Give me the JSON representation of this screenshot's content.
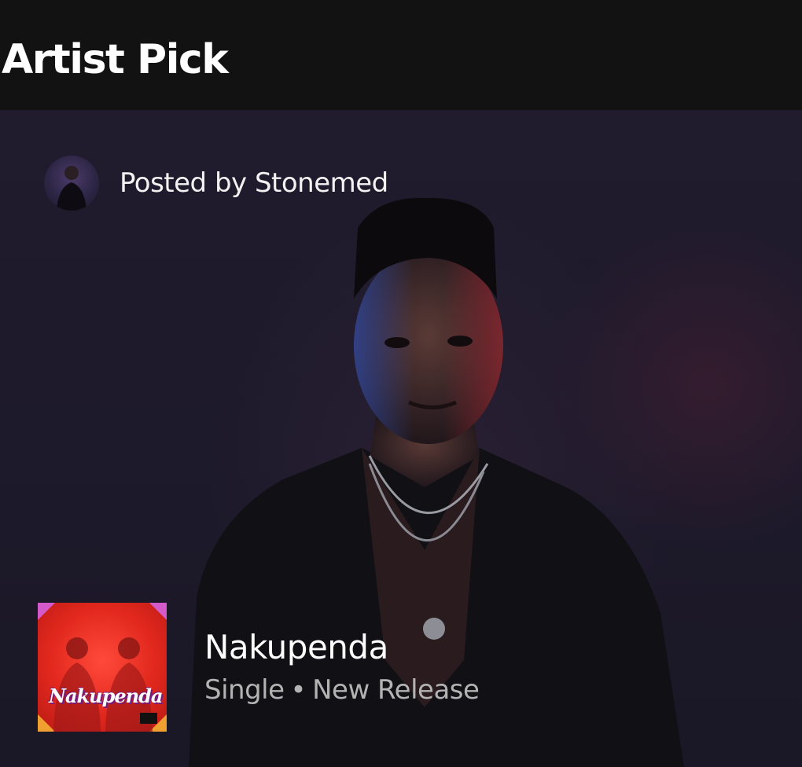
{
  "section": {
    "title": "Artist Pick"
  },
  "post": {
    "posted_by": "Posted by Stonemed",
    "avatar_icon": "artist-avatar"
  },
  "release": {
    "title": "Nakupenda",
    "type": "Single",
    "separator": "•",
    "status": "New Release",
    "cover_text": "Nakupenda",
    "cover_icon": "album-cover"
  },
  "colors": {
    "background": "#121212",
    "card": "#1e1a2b",
    "title_text": "#ffffff",
    "secondary_text": "#b3b3b3",
    "cover_red": "#e2281e"
  }
}
